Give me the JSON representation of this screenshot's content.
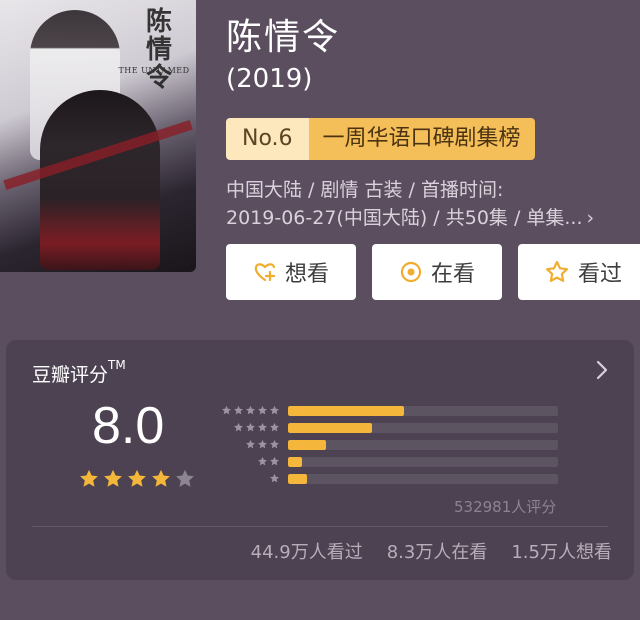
{
  "title": "陈情令",
  "year": "(2019)",
  "ranking": {
    "number": "No.6",
    "list_name": "一周华语口碑剧集榜"
  },
  "meta": {
    "line1": "中国大陆 / 剧情 古装 / 首播时间:",
    "line2": "2019-06-27(中国大陆) / 共50集 / 单集...",
    "chevron": "›"
  },
  "actions": {
    "want": "想看",
    "watching": "在看",
    "watched": "看过"
  },
  "rating": {
    "label": "豆瓣评分",
    "trademark": "TM",
    "score": "8.0",
    "stars_filled": 4,
    "stars_total": 5,
    "distribution": [
      {
        "stars": 5,
        "fraction": 0.43
      },
      {
        "stars": 4,
        "fraction": 0.31
      },
      {
        "stars": 3,
        "fraction": 0.14
      },
      {
        "stars": 2,
        "fraction": 0.05
      },
      {
        "stars": 1,
        "fraction": 0.07
      }
    ],
    "count": "532981人评分",
    "stats": {
      "watched": "44.9万人看过",
      "watching": "8.3万人在看",
      "want": "1.5万人想看"
    }
  },
  "poster": {
    "title_art": "陈情令",
    "subtitle_art": "THE UNTAMED"
  },
  "colors": {
    "background": "#5a4e5f",
    "card": "#4c4251",
    "accent": "#f4b63b",
    "rank_light": "#fde7bd",
    "rank_dark": "#f4be58"
  }
}
